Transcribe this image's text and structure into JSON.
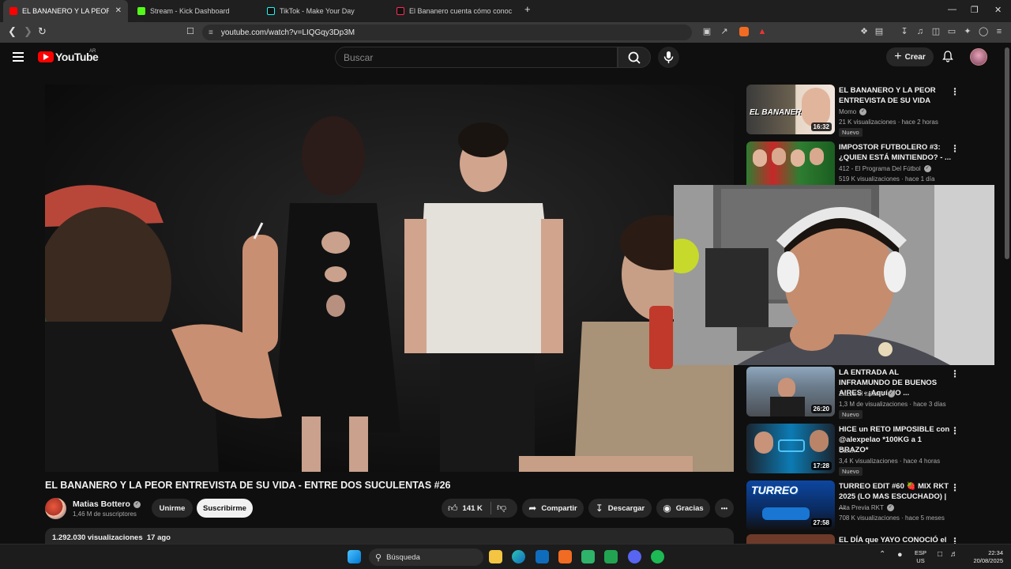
{
  "browser": {
    "tabs": [
      {
        "title": "EL BANANERO Y LA PEOR EN",
        "favicon": "youtube-icon",
        "active": true
      },
      {
        "title": "Stream - Kick Dashboard",
        "favicon": "kick-icon",
        "active": false
      },
      {
        "title": "TikTok - Make Your Day",
        "favicon": "tiktok-icon",
        "active": false
      },
      {
        "title": "El Bananero cuenta cómo conoció a",
        "favicon": "tiktok-icon",
        "active": false
      }
    ],
    "close_glyph": "✕",
    "new_tab_glyph": "+",
    "url": "youtube.com/watch?v=LIQGqy3Dp3M"
  },
  "youtube": {
    "logo_text": "YouTube",
    "country": "AR",
    "search_placeholder": "Buscar",
    "create_label": "Crear"
  },
  "video": {
    "title": "EL BANANERO Y LA PEOR ENTREVISTA DE SU VIDA - ENTRE DOS SUCULENTAS #26",
    "channel": "Matias Bottero",
    "subscribers": "1,46 M de suscriptores",
    "join_label": "Unirme",
    "subscribe_label": "Suscribirme",
    "likes": "141 K",
    "share_label": "Compartir",
    "download_label": "Descargar",
    "thanks_label": "Gracias",
    "more_label": "•••",
    "views": "1.292.030 visualizaciones",
    "age": "17 ago"
  },
  "recommendations": [
    {
      "title": "EL BANANERO Y LA PEOR ENTREVISTA DE SU VIDA",
      "channel": "Momo",
      "verified": true,
      "meta": "21 K visualizaciones · hace 2 horas",
      "badge": "Nuevo",
      "duration": "16:32"
    },
    {
      "title": "IMPOSTOR FUTBOLERO #3: ¿QUIEN ESTÁ MINTIENDO? - ...",
      "channel": "412 - El Programa Del Fútbol",
      "verified": true,
      "meta": "519 K visualizaciones · hace 1 día",
      "badge": "",
      "duration": ""
    },
    {
      "title": "LA ENTRADA AL INFRAMUNDO DE BUENOS AIRES - ¡Aquí NO ...",
      "channel": "Zazza el italiano",
      "verified": true,
      "meta": "1,3 M de visualizaciones · hace 3 días",
      "badge": "Nuevo",
      "duration": "26:20"
    },
    {
      "title": "HICE un RETO IMPOSIBLE con @alexpelao *100KG a 1 BRAZO*",
      "channel": "Canin",
      "verified": false,
      "meta": "3,4 K visualizaciones · hace 4 horas",
      "badge": "Nuevo",
      "duration": "17:28"
    },
    {
      "title": "TURREO EDIT #60 🍓 MIX RKT 2025 (LO MAS ESCUCHADO) | ...",
      "channel": "Alta Previa RKT",
      "verified": true,
      "meta": "708 K visualizaciones · hace 5 meses",
      "badge": "",
      "duration": "27:58"
    },
    {
      "title": "EL DÍA que YAYO CONOCIÓ el",
      "channel": "",
      "verified": false,
      "meta": "",
      "badge": "",
      "duration": ""
    }
  ],
  "thumb_texts": {
    "t1": "EL BANANERO",
    "t5": "TURREO"
  },
  "taskbar": {
    "search_label": "Búsqueda",
    "lang_top": "ESP",
    "lang_bottom": "US",
    "time": "22:34",
    "date": "20/08/2025"
  },
  "colors": {
    "youtube_red": "#ff0000",
    "background": "#0f0f0f",
    "pill": "#272727"
  }
}
